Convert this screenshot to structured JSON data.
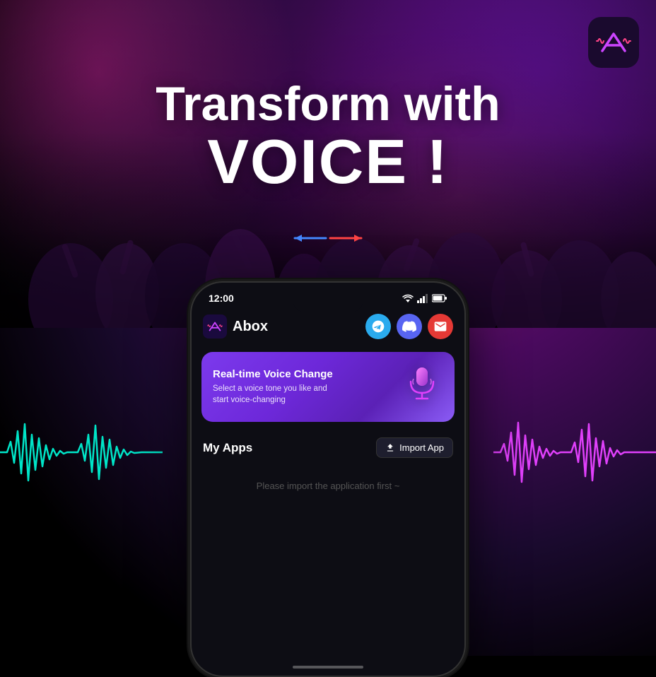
{
  "app": {
    "logo_label": "Abox Logo",
    "name": "Abox"
  },
  "headline": {
    "line1": "Transform with",
    "line2": "VOICE !"
  },
  "arrow": {
    "left_color": "#4488ff",
    "right_color": "#ff4444"
  },
  "phone": {
    "status_bar": {
      "time": "12:00",
      "signal": "▼",
      "wifi": "▲",
      "battery": "🔋"
    },
    "header": {
      "app_name": "Abox"
    },
    "social_buttons": [
      {
        "name": "telegram",
        "label": "Telegram"
      },
      {
        "name": "discord",
        "label": "Discord"
      },
      {
        "name": "email",
        "label": "Email"
      }
    ],
    "voice_card": {
      "title": "Real-time Voice Change",
      "description": "Select a voice tone you like and start voice-changing"
    },
    "my_apps": {
      "title": "My Apps",
      "import_button": "Import App",
      "placeholder": "Please import the application first ~"
    }
  },
  "waveform": {
    "left_color": "#00e5c8",
    "right_color": "#e040fb"
  }
}
